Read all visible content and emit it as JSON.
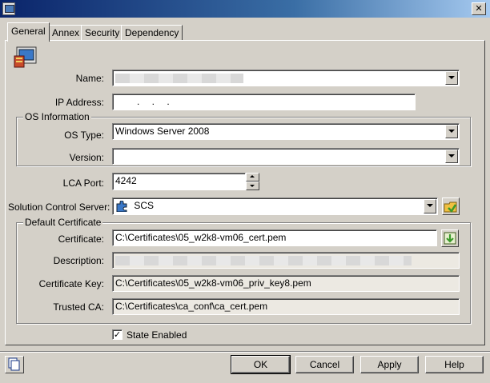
{
  "window": {
    "title": ""
  },
  "tabs": [
    {
      "label": "General",
      "active": true
    },
    {
      "label": "Annex"
    },
    {
      "label": "Security"
    },
    {
      "label": "Dependency"
    }
  ],
  "form": {
    "name": {
      "label": "Name:",
      "value": ""
    },
    "ip_address": {
      "label": "IP Address:",
      "value": "  .  .  ."
    },
    "os_group": {
      "title": "OS Information",
      "os_type": {
        "label": "OS Type:",
        "value": "Windows Server 2008"
      },
      "version": {
        "label": "Version:",
        "value": ""
      }
    },
    "lca_port": {
      "label": "LCA Port:",
      "value": "4242"
    },
    "solution_control_server": {
      "label": "Solution Control Server:",
      "value": "SCS",
      "icon": "puzzle-icon"
    },
    "cert_group": {
      "title": "Default Certificate",
      "certificate": {
        "label": "Certificate:",
        "value": "C:\\Certificates\\05_w2k8-vm06_cert.pem"
      },
      "description": {
        "label": "Description:",
        "value": ""
      },
      "certificate_key": {
        "label": "Certificate Key:",
        "value": "C:\\Certificates\\05_w2k8-vm06_priv_key8.pem"
      },
      "trusted_ca": {
        "label": "Trusted CA:",
        "value": "C:\\Certificates\\ca_conf\\ca_cert.pem"
      }
    },
    "state_enabled": {
      "label": "State Enabled",
      "checked": true
    }
  },
  "buttons": {
    "ok": "OK",
    "cancel": "Cancel",
    "apply": "Apply",
    "help": "Help"
  },
  "colors": {
    "titlebar": "#0a246a",
    "dialog_bg": "#d4d0c8",
    "accent_green": "#3a9a2a"
  }
}
